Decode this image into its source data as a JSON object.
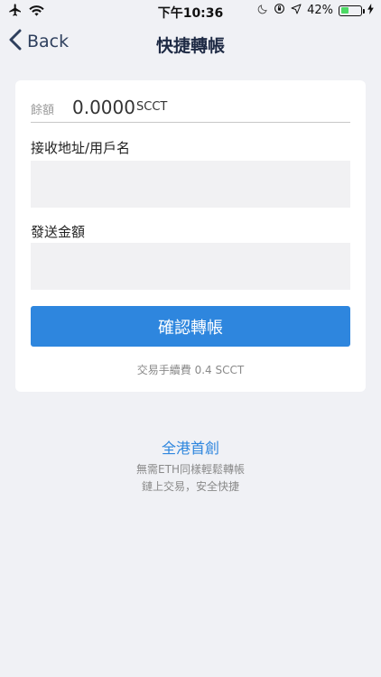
{
  "status_bar": {
    "time": "下午10:36",
    "battery_percent_label": "42%",
    "battery_level": 0.42,
    "icons": [
      "airplane-icon",
      "wifi-icon",
      "moon-icon",
      "orientation-lock-icon",
      "location-icon",
      "battery-icon",
      "charging-icon"
    ]
  },
  "nav": {
    "back_label": "Back",
    "title": "快捷轉帳"
  },
  "form": {
    "balance_label": "餘額",
    "balance_value": "0.0000",
    "balance_unit": "SCCT",
    "recipient_label": "接收地址/用戶名",
    "recipient_value": "",
    "amount_label": "發送金額",
    "amount_value": "",
    "confirm_label": "確認轉帳",
    "fee_text": "交易手續費 0.4 SCCT"
  },
  "promo": {
    "title": "全港首創",
    "line1": "無需ETH同樣輕鬆轉帳",
    "line2": "鏈上交易，安全快捷"
  },
  "colors": {
    "accent": "#2e86de",
    "background": "#f0f1f5",
    "battery": "#4cd964"
  }
}
